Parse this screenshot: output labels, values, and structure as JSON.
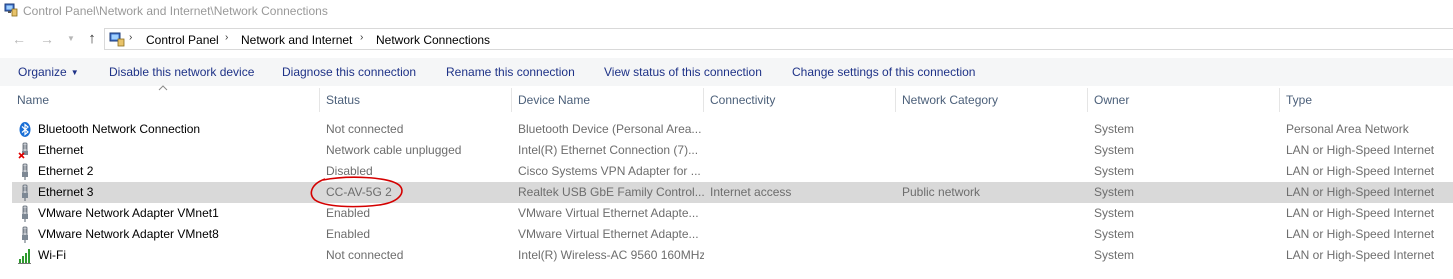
{
  "window": {
    "title": "Control Panel\\Network and Internet\\Network Connections"
  },
  "address": {
    "breadcrumbs": [
      "Control Panel",
      "Network and Internet",
      "Network Connections"
    ],
    "separator": "›"
  },
  "toolbar": {
    "organize_label": "Organize",
    "commands": [
      "Disable this network device",
      "Diagnose this connection",
      "Rename this connection",
      "View status of this connection",
      "Change settings of this connection"
    ]
  },
  "table": {
    "columns": [
      "Name",
      "Status",
      "Device Name",
      "Connectivity",
      "Network Category",
      "Owner",
      "Type"
    ],
    "rows": [
      {
        "icon": "bluetooth-network-icon",
        "name": "Bluetooth Network Connection",
        "status": "Not connected",
        "device": "Bluetooth Device (Personal Area...",
        "connectivity": "",
        "category": "",
        "owner": "System",
        "type": "Personal Area Network",
        "selected": false
      },
      {
        "icon": "ethernet-disconnected-icon",
        "name": "Ethernet",
        "status": "Network cable unplugged",
        "device": "Intel(R) Ethernet Connection (7)...",
        "connectivity": "",
        "category": "",
        "owner": "System",
        "type": "LAN or High-Speed Internet",
        "selected": false
      },
      {
        "icon": "ethernet-icon",
        "name": "Ethernet 2",
        "status": "Disabled",
        "device": "Cisco Systems VPN Adapter for ...",
        "connectivity": "",
        "category": "",
        "owner": "System",
        "type": "LAN or High-Speed Internet",
        "selected": false
      },
      {
        "icon": "ethernet-icon",
        "name": "Ethernet 3",
        "status": "CC-AV-5G 2",
        "device": "Realtek USB GbE Family Control...",
        "connectivity": "Internet access",
        "category": "Public network",
        "owner": "System",
        "type": "LAN or High-Speed Internet",
        "selected": true
      },
      {
        "icon": "ethernet-icon",
        "name": "VMware Network Adapter VMnet1",
        "status": "Enabled",
        "device": "VMware Virtual Ethernet Adapte...",
        "connectivity": "",
        "category": "",
        "owner": "System",
        "type": "LAN or High-Speed Internet",
        "selected": false
      },
      {
        "icon": "ethernet-icon",
        "name": "VMware Network Adapter VMnet8",
        "status": "Enabled",
        "device": "VMware Virtual Ethernet Adapte...",
        "connectivity": "",
        "category": "",
        "owner": "System",
        "type": "LAN or High-Speed Internet",
        "selected": false
      },
      {
        "icon": "wifi-signal-icon",
        "name": "Wi-Fi",
        "status": "Not connected",
        "device": "Intel(R) Wireless-AC 9560 160MHz",
        "connectivity": "",
        "category": "",
        "owner": "System",
        "type": "LAN or High-Speed Internet",
        "selected": false
      }
    ]
  },
  "colors": {
    "link": "#1e3287",
    "header_text": "#4c607a",
    "secondary_text": "#6d6d6d",
    "selection": "#d9d9d9",
    "annotation": "#d40000",
    "command_bar": "#f5f6f7"
  }
}
